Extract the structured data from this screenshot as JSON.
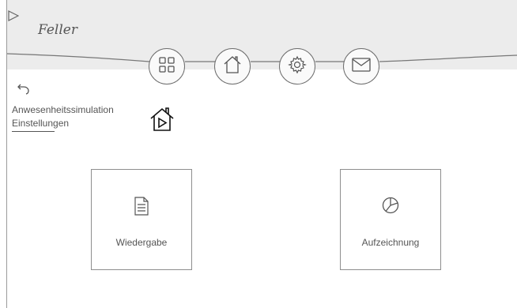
{
  "header": {
    "logo_text": "Feller"
  },
  "nav": {
    "items": [
      {
        "name": "apps",
        "icon": "grid-icon",
        "active": true
      },
      {
        "name": "home",
        "icon": "home-icon"
      },
      {
        "name": "settings",
        "icon": "gear-icon"
      },
      {
        "name": "messages",
        "icon": "mail-icon"
      }
    ]
  },
  "page": {
    "title_line1": "Anwesenheitssimulation",
    "title_line2": "Einstellungen",
    "icon": "home-play-icon"
  },
  "tiles": [
    {
      "label": "Wiedergabe",
      "icon": "document-icon"
    },
    {
      "label": "Aufzeichnung",
      "icon": "pie-chart-icon"
    }
  ],
  "colors": {
    "header_bg": "#ececec",
    "border": "#6e6e6e",
    "text": "#555555"
  }
}
